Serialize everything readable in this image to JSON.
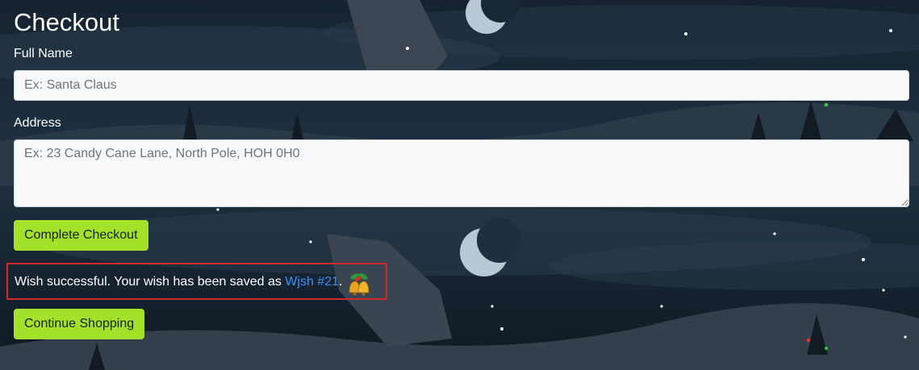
{
  "page": {
    "title": "Checkout"
  },
  "form": {
    "full_name": {
      "label": "Full Name",
      "placeholder": "Ex: Santa Claus",
      "value": ""
    },
    "address": {
      "label": "Address",
      "placeholder": "Ex: 23 Candy Cane Lane, North Pole, HOH 0H0",
      "value": ""
    },
    "submit_label": "Complete Checkout"
  },
  "result": {
    "message_prefix": "Wish successful. Your wish has been saved as ",
    "wish_link": "Wjsh #21",
    "message_suffix": ".",
    "icon": "christmas-bells-icon"
  },
  "actions": {
    "continue_label": "Continue Shopping"
  },
  "colors": {
    "button_bg": "#a4e12a",
    "link": "#3a8ff7",
    "highlight_border": "#d12b2b",
    "background": "#14202e"
  }
}
